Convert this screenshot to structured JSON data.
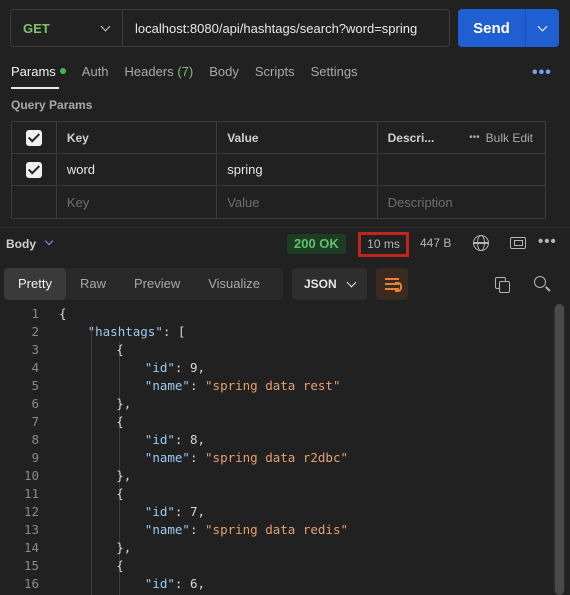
{
  "request": {
    "method": "GET",
    "url": "localhost:8080/api/hashtags/search?word=spring",
    "send_label": "Send"
  },
  "tabs": [
    {
      "label": "Params",
      "active": true
    },
    {
      "label": "Auth"
    },
    {
      "label": "Headers",
      "count": "(7)"
    },
    {
      "label": "Body"
    },
    {
      "label": "Scripts"
    },
    {
      "label": "Settings"
    }
  ],
  "query_params": {
    "title": "Query Params",
    "columns": {
      "key": "Key",
      "value": "Value",
      "description": "Descri...",
      "bulk_edit": "Bulk Edit"
    },
    "rows": [
      {
        "checked": true,
        "key": "word",
        "value": "spring",
        "description": ""
      }
    ],
    "placeholders": {
      "key": "Key",
      "value": "Value",
      "description": "Description"
    }
  },
  "response": {
    "body_label": "Body",
    "status": "200 OK",
    "time": "10 ms",
    "size": "447 B",
    "view_tabs": [
      "Pretty",
      "Raw",
      "Preview",
      "Visualize"
    ],
    "active_view": "Pretty",
    "format": "JSON"
  },
  "code_lines": [
    {
      "n": "1",
      "indent": 0,
      "text": "{"
    },
    {
      "n": "2",
      "indent": 1,
      "key": "\"hashtags\"",
      "rest": ": ["
    },
    {
      "n": "3",
      "indent": 2,
      "text": "{"
    },
    {
      "n": "4",
      "indent": 3,
      "key": "\"id\"",
      "rest": ": ",
      "num": "9",
      "tail": ","
    },
    {
      "n": "5",
      "indent": 3,
      "key": "\"name\"",
      "rest": ": ",
      "str": "\"spring data rest\""
    },
    {
      "n": "6",
      "indent": 2,
      "text": "},"
    },
    {
      "n": "7",
      "indent": 2,
      "text": "{"
    },
    {
      "n": "8",
      "indent": 3,
      "key": "\"id\"",
      "rest": ": ",
      "num": "8",
      "tail": ","
    },
    {
      "n": "9",
      "indent": 3,
      "key": "\"name\"",
      "rest": ": ",
      "str": "\"spring data r2dbc\""
    },
    {
      "n": "10",
      "indent": 2,
      "text": "},"
    },
    {
      "n": "11",
      "indent": 2,
      "text": "{"
    },
    {
      "n": "12",
      "indent": 3,
      "key": "\"id\"",
      "rest": ": ",
      "num": "7",
      "tail": ","
    },
    {
      "n": "13",
      "indent": 3,
      "key": "\"name\"",
      "rest": ": ",
      "str": "\"spring data redis\""
    },
    {
      "n": "14",
      "indent": 2,
      "text": "},"
    },
    {
      "n": "15",
      "indent": 2,
      "text": "{"
    },
    {
      "n": "16",
      "indent": 3,
      "key": "\"id\"",
      "rest": ": ",
      "num": "6",
      "tail": ","
    }
  ],
  "icons": {
    "globe": "globe-icon",
    "save": "save-response-icon",
    "copy": "copy-icon",
    "search": "search-icon",
    "wrap": "wrap-lines-icon"
  },
  "colors": {
    "method": "#7cc36b",
    "send": "#1f5fd1",
    "status_bg": "#1c3d24",
    "status_text": "#5fc06f",
    "highlight_box": "#c0261e",
    "json_key": "#9cc8ef",
    "json_string": "#e6a070"
  }
}
